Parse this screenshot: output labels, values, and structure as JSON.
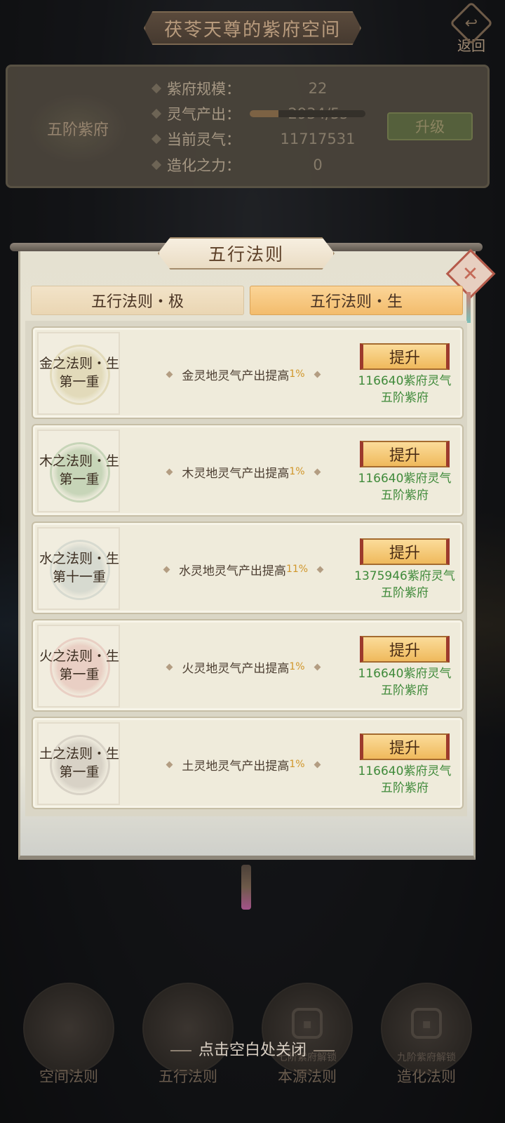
{
  "header": {
    "title": "茯苓天尊的紫府空间",
    "back_label": "返回"
  },
  "info": {
    "seal_label": "五阶紫府",
    "rows": [
      {
        "label": "紫府规模：",
        "value": "22"
      },
      {
        "label": "灵气产出：",
        "value": "2934/5s"
      },
      {
        "label": "当前灵气：",
        "value": "11717531"
      },
      {
        "label": "造化之力：",
        "value": "0"
      }
    ],
    "production_progress": 0.25,
    "upgrade_label": "升级"
  },
  "dialog": {
    "title": "五行法则",
    "close_icon": "close-x-icon",
    "tabs": [
      {
        "label": "五行法则・极",
        "active": false
      },
      {
        "label": "五行法则・生",
        "active": true
      }
    ],
    "laws": [
      {
        "name_line1": "金之法则・生",
        "name_line2": "第一重",
        "desc": "金灵地灵气产出提高",
        "pct": "1%",
        "button": "提升",
        "cost": "116640紫府灵气",
        "requirement": "五阶紫府",
        "ring_color": "#d6cc9c"
      },
      {
        "name_line1": "木之法则・生",
        "name_line2": "第一重",
        "desc": "木灵地灵气产出提高",
        "pct": "1%",
        "button": "提升",
        "cost": "116640紫府灵气",
        "requirement": "五阶紫府",
        "ring_color": "#a6c29a"
      },
      {
        "name_line1": "水之法则・生",
        "name_line2": "第十一重",
        "desc": "水灵地灵气产出提高",
        "pct": "11%",
        "button": "提升",
        "cost": "1375946紫府灵气",
        "requirement": "五阶紫府",
        "ring_color": "#c3cbc4"
      },
      {
        "name_line1": "火之法则・生",
        "name_line2": "第一重",
        "desc": "火灵地灵气产出提高",
        "pct": "1%",
        "button": "提升",
        "cost": "116640紫府灵气",
        "requirement": "五阶紫府",
        "ring_color": "#e3b8ae"
      },
      {
        "name_line1": "土之法则・生",
        "name_line2": "第一重",
        "desc": "土灵地灵气产出提高",
        "pct": "1%",
        "button": "提升",
        "cost": "116640紫府灵气",
        "requirement": "五阶紫府",
        "ring_color": "#c4bdb3"
      }
    ]
  },
  "close_hint": "点击空白处关闭",
  "nav": [
    {
      "label": "空间法则",
      "lock": ""
    },
    {
      "label": "五行法则",
      "lock": ""
    },
    {
      "label": "本源法则",
      "lock": "七阶紫府解锁"
    },
    {
      "label": "造化法则",
      "lock": "九阶紫府解锁"
    }
  ]
}
